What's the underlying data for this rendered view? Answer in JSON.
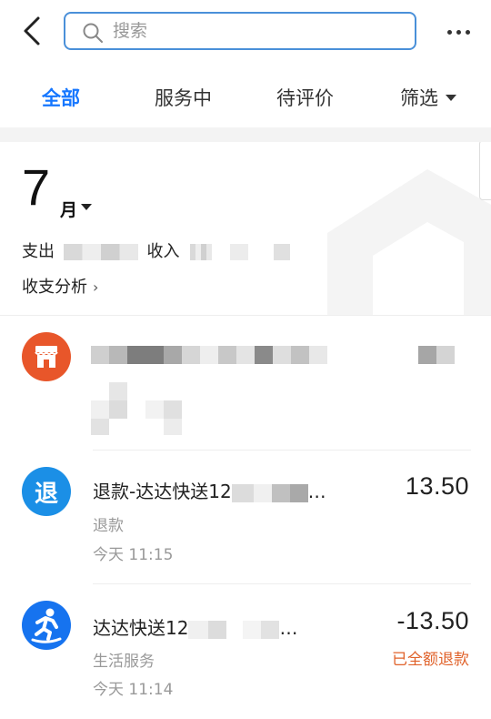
{
  "header": {
    "search_placeholder": "搜索"
  },
  "tabs": [
    {
      "label": "全部",
      "active": true
    },
    {
      "label": "服务中",
      "active": false
    },
    {
      "label": "待评价",
      "active": false
    },
    {
      "label": "筛选",
      "active": false
    }
  ],
  "summary": {
    "month": "7",
    "month_unit": "月",
    "expense_label": "支出",
    "income_label": "收入",
    "analysis_label": "收支分析"
  },
  "transactions": [
    {
      "icon": "store-icon",
      "icon_color": "#e8562a"
    },
    {
      "icon": "refund-icon",
      "icon_color": "#1b8fe6",
      "icon_text": "退",
      "title_visible": "退款-达达快送12",
      "title_suffix": "…",
      "category": "退款",
      "time": "今天 11:15",
      "amount": "13.50"
    },
    {
      "icon": "runner-icon",
      "icon_color": "#1673ef",
      "title_visible": "达达快送12",
      "title_suffix": "…",
      "category": "生活服务",
      "time": "今天 11:14",
      "amount": "-13.50",
      "status": "已全额退款"
    }
  ],
  "colors": {
    "accent": "#1677ff",
    "refund_status": "#e0622a"
  }
}
